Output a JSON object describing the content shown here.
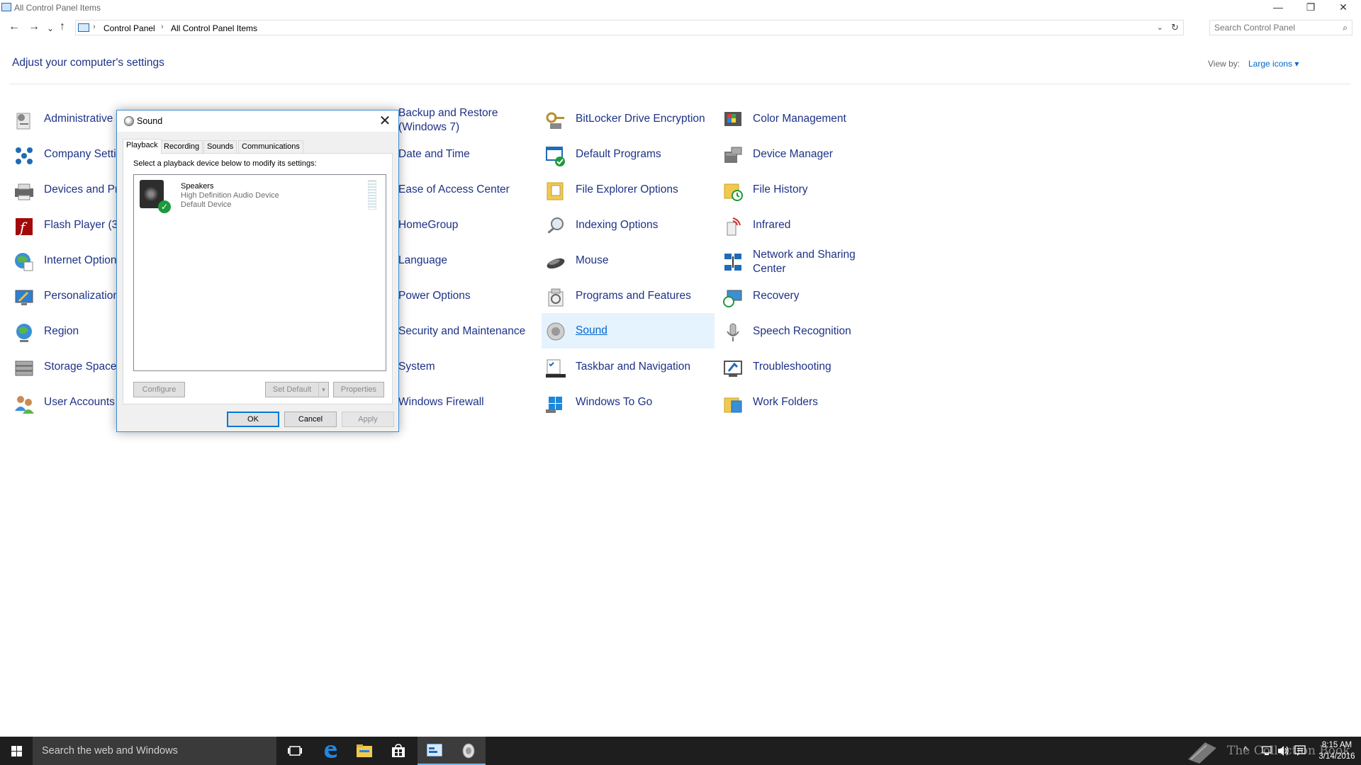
{
  "window": {
    "title": "All Control Panel Items",
    "minimize": "—",
    "restore": "❐",
    "close": "✕"
  },
  "nav": {
    "back": "←",
    "forward": "→",
    "recent": "⌄",
    "up": "↑"
  },
  "address": {
    "crumbs": [
      "Control Panel",
      "All Control Panel Items"
    ],
    "separator": "›",
    "dropdown": "⌄",
    "refresh": "↻"
  },
  "search": {
    "placeholder": "Search Control Panel",
    "icon": "⌕"
  },
  "header": {
    "title": "Adjust your computer's settings",
    "view_by_label": "View by:",
    "view_by_value": "Large icons ▾"
  },
  "items": {
    "col1": [
      "Administrative Tools",
      "Company Settings",
      "Devices and Printers",
      "Flash Player (32-bit)",
      "Internet Options",
      "Personalization",
      "Region",
      "Storage Spaces",
      "User Accounts"
    ],
    "col2": [
      "Backup and Restore (Windows 7)",
      "Date and Time",
      "Ease of Access Center",
      "HomeGroup",
      "Language",
      "Power Options",
      "Security and Maintenance",
      "System",
      "Windows Firewall"
    ],
    "col3": [
      "BitLocker Drive Encryption",
      "Default Programs",
      "File Explorer Options",
      "Indexing Options",
      "Mouse",
      "Programs and Features",
      "Sound",
      "Taskbar and Navigation",
      "Windows To Go"
    ],
    "col4": [
      "Color Management",
      "Device Manager",
      "File History",
      "Infrared",
      "Network and Sharing Center",
      "Recovery",
      "Speech Recognition",
      "Troubleshooting",
      "Work Folders"
    ]
  },
  "dialog": {
    "title": "Sound",
    "close": "✕",
    "tabs": [
      "Playback",
      "Recording",
      "Sounds",
      "Communications"
    ],
    "instruction": "Select a playback device below to modify its settings:",
    "device": {
      "name": "Speakers",
      "description": "High Definition Audio Device",
      "status": "Default Device",
      "check": "✓"
    },
    "buttons": {
      "configure": "Configure",
      "set_default": "Set Default",
      "set_default_arrow": "▾",
      "properties": "Properties",
      "ok": "OK",
      "cancel": "Cancel",
      "apply": "Apply"
    }
  },
  "taskbar": {
    "search_placeholder": "Search the web and Windows",
    "time": "8:15 AM",
    "date": "3/14/2016",
    "watermark": "The Collection Book",
    "tray_chevron": "^"
  },
  "colors": {
    "link": "#1e3287",
    "accent": "#0078d7",
    "taskbar": "#1e1e1e",
    "selected_bg": "#e5f3ff"
  }
}
